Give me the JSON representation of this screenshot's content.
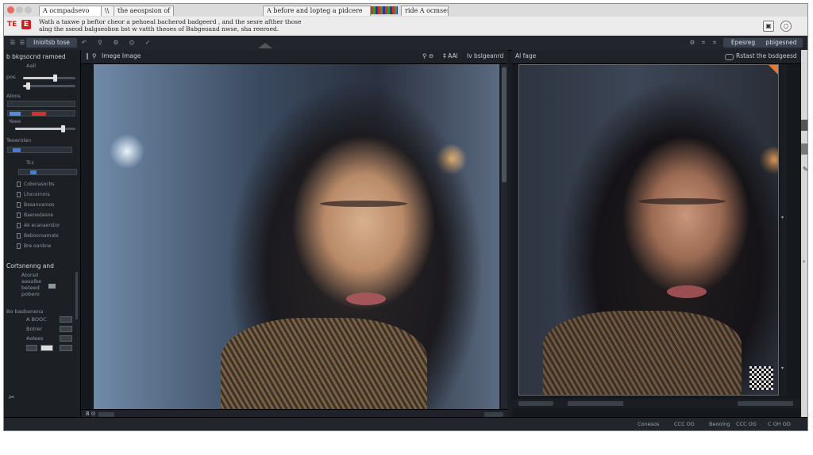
{
  "tabs": [
    {
      "label": "A ocmpadsevo"
    },
    {
      "label": "\\\\"
    },
    {
      "label": "the aeospsion of"
    },
    {
      "label": "A before and lopteg a pidcere"
    },
    {
      "label": "ride A ocmsen"
    }
  ],
  "infobar": {
    "favicons": [
      "TE",
      "E"
    ],
    "line1": "Wath a taxwe p beftor cheor a pehoeal bacherod badgeerd , and the sesre afther those",
    "line2": "alng the sseod balgseobon bst w vatth theoes of Babgeoand nwse, sha reeroed."
  },
  "toolbar": {
    "items": [
      "☰",
      "☰",
      "Inloltsb tose",
      "↶",
      "⚲",
      "⚙",
      "⛭",
      "✓"
    ],
    "right_items": [
      "⚙",
      "⌗",
      "⌗",
      "Epesreg",
      "pbigesned"
    ]
  },
  "leftpanel": {
    "title": "b bkgsocnd ramoed",
    "sections": [
      "Aall",
      "Aloos",
      "Yeee",
      "Teoerolan",
      "Cortsnenng and",
      "Bo basbanena"
    ],
    "checkbox_labels": [
      "Coborasocbs",
      "Lhxcernms",
      "Basanvaroos",
      "Baenedasne",
      "Ak ecanaerstor",
      "Bebooroamats",
      "Bre oanbne"
    ],
    "small_labels": [
      "pos",
      "Tcc",
      "Atorsd",
      "aasalbe",
      "beteed",
      "pobero"
    ],
    "buttons": [
      "A BOOC",
      "Botrer",
      "Aolees"
    ]
  },
  "left_pane": {
    "header": "Imege Image",
    "icons": [
      "‖",
      "⚲"
    ],
    "header_right": "⚲ ⊖"
  },
  "right_pane": {
    "header_left": "‡ AAl",
    "header_mid": "Iv bslgeanrd",
    "header_label": "Al fage",
    "header_right": "Rstast the bsdgeesd"
  },
  "statusbar": {
    "items": [
      "Conesos",
      "CCC OG",
      "Beoolng",
      "CCC OG",
      "C OH OD"
    ]
  },
  "colors": {
    "app_bg": "#1a1d22",
    "panel_bg": "#1c1f24",
    "accent": "#3a4250"
  }
}
